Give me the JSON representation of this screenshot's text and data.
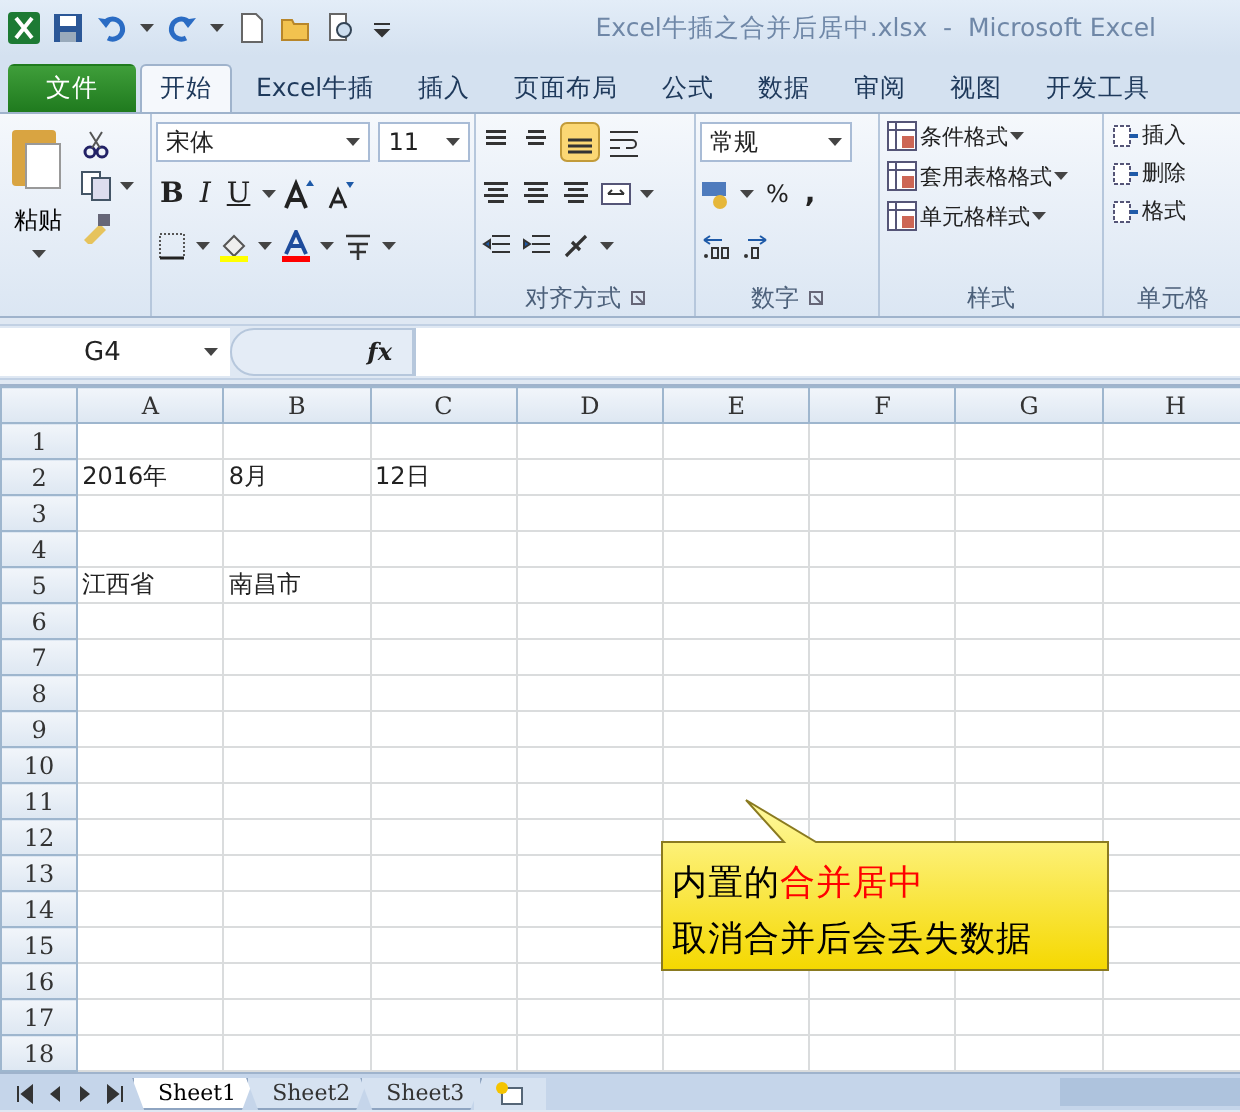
{
  "window": {
    "title": "Excel牛插之合并后居中.xlsx  -  Microsoft Excel"
  },
  "tabs": [
    {
      "label": "文件",
      "kind": "file",
      "selected": false
    },
    {
      "label": "开始",
      "kind": "tab",
      "selected": true
    },
    {
      "label": "Excel牛插",
      "kind": "tab",
      "selected": false
    },
    {
      "label": "插入",
      "kind": "tab",
      "selected": false
    },
    {
      "label": "页面布局",
      "kind": "tab",
      "selected": false
    },
    {
      "label": "公式",
      "kind": "tab",
      "selected": false
    },
    {
      "label": "数据",
      "kind": "tab",
      "selected": false
    },
    {
      "label": "审阅",
      "kind": "tab",
      "selected": false
    },
    {
      "label": "视图",
      "kind": "tab",
      "selected": false
    },
    {
      "label": "开发工具",
      "kind": "tab",
      "selected": false
    }
  ],
  "ribbon": {
    "paste_label": "粘贴",
    "font_name": "宋体",
    "font_size": "11",
    "font_style_buttons": [
      "B",
      "I",
      "U"
    ],
    "number_format": "常规",
    "percent": "%",
    "comma": ",",
    "style_buttons": [
      "条件格式",
      "套用表格格式",
      "单元格样式"
    ],
    "cell_buttons": [
      "插入",
      "删除",
      "格式"
    ],
    "group_labels": {
      "alignment": "对齐方式",
      "number": "数字",
      "styles": "样式",
      "cells": "单元格"
    }
  },
  "formula_bar": {
    "name_box": "G4",
    "function_label": "fx"
  },
  "sheet": {
    "columns": [
      "A",
      "B",
      "C",
      "D",
      "E",
      "F",
      "G",
      "H"
    ],
    "rows": [
      {
        "header": "1"
      },
      {
        "header": "2",
        "cells": [
          "2016年",
          "8月",
          "12日"
        ]
      },
      {
        "header": "3"
      },
      {
        "header": "4"
      },
      {
        "header": "5",
        "cells": [
          "江西省",
          "南昌市"
        ]
      },
      {
        "header": "6"
      },
      {
        "header": "7"
      },
      {
        "header": "8"
      },
      {
        "header": "9"
      },
      {
        "header": "10"
      },
      {
        "header": "11"
      },
      {
        "header": "12"
      },
      {
        "header": "13"
      },
      {
        "header": "14"
      },
      {
        "header": "15"
      },
      {
        "header": "16"
      },
      {
        "header": "17"
      },
      {
        "header": "18"
      }
    ]
  },
  "sheet_tabs": [
    {
      "label": "Sheet1",
      "selected": true
    },
    {
      "label": "Sheet2",
      "selected": false
    },
    {
      "label": "Sheet3",
      "selected": false
    }
  ],
  "callout": {
    "lines": [
      {
        "segments": [
          {
            "text": "内置的",
            "highlight": false
          },
          {
            "text": "合并居中",
            "highlight": true
          }
        ]
      },
      {
        "segments": [
          {
            "text": "取消合并后会丢失数据",
            "highlight": false
          }
        ]
      }
    ]
  }
}
